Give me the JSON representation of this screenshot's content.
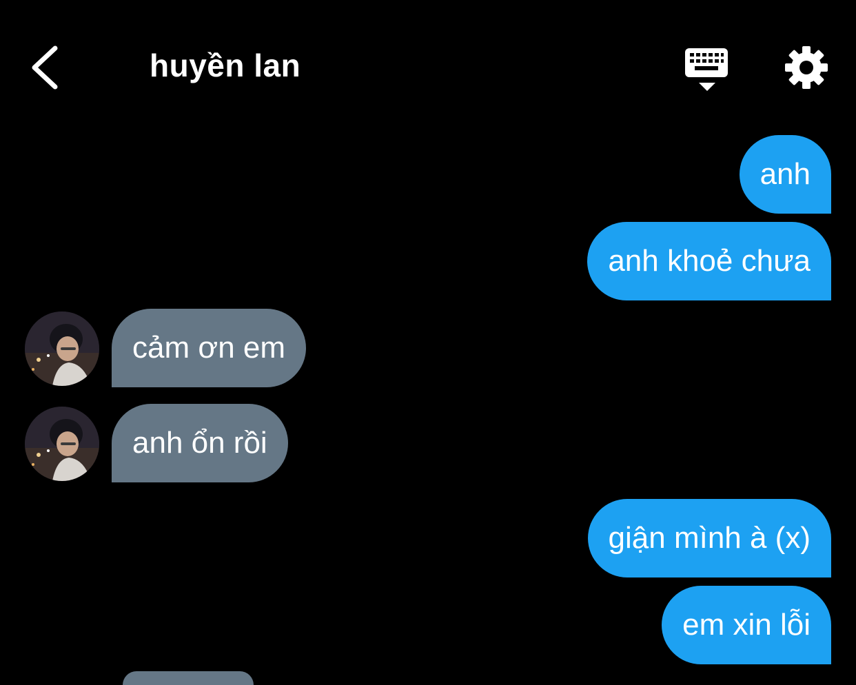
{
  "header": {
    "title": "huyền lan",
    "back_icon": "chevron-left-icon",
    "keyboard_icon": "keyboard-icon",
    "settings_icon": "gear-icon"
  },
  "messages": [
    {
      "direction": "sent",
      "text": "anh"
    },
    {
      "direction": "sent",
      "text": "anh khoẻ chưa"
    },
    {
      "direction": "received",
      "text": "cảm ơn em"
    },
    {
      "direction": "received",
      "text": "anh ổn rồi"
    },
    {
      "direction": "sent",
      "text": "giận mình à (x)"
    },
    {
      "direction": "sent",
      "text": "em xin lỗi"
    }
  ],
  "colors": {
    "background": "#000000",
    "sent_bubble": "#1da1f2",
    "received_bubble": "#657786",
    "text": "#ffffff"
  }
}
